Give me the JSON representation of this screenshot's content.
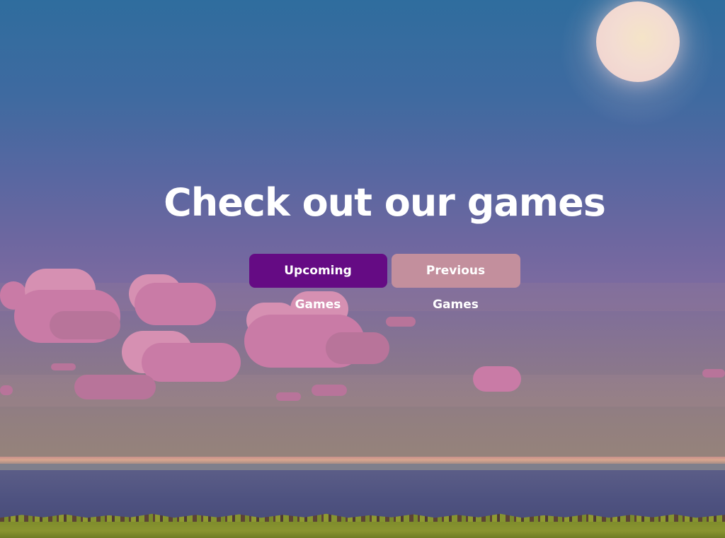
{
  "hero": {
    "title": "Check out our games",
    "buttons": {
      "upcoming_label": "Upcoming Games",
      "previous_label": "Previous Games"
    }
  },
  "colors": {
    "primary_button": "#650b84",
    "secondary_button": "#c38f9d",
    "title_text": "#ffffff"
  },
  "background": {
    "scene": "pixel-art-dusk-sky",
    "elements": [
      "moon",
      "pink-clouds",
      "sea",
      "grass"
    ]
  }
}
